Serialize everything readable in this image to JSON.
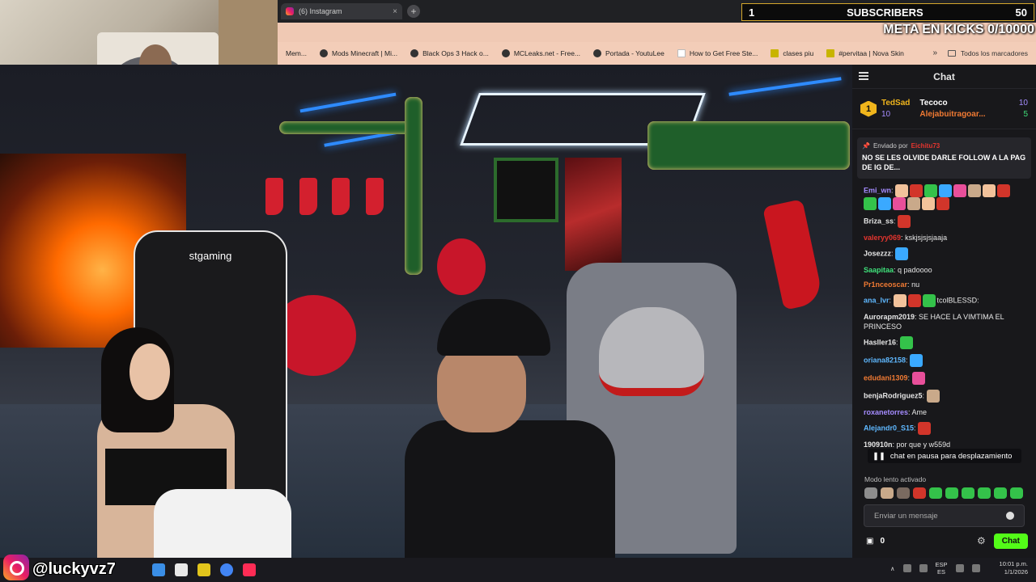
{
  "browser": {
    "tab_title": "(6) Instagram",
    "tab_close": "×",
    "new_tab": "+",
    "window_controls": [
      "—",
      "▢",
      "✕"
    ],
    "bookmarks": [
      {
        "label": "Mem..."
      },
      {
        "label": "Mods Minecraft | Mi..."
      },
      {
        "label": "Black Ops 3 Hack o..."
      },
      {
        "label": "MCLeaks.net - Free..."
      },
      {
        "label": "Portada - YoutuLee"
      },
      {
        "label": "How to Get Free Ste..."
      },
      {
        "label": "clases piu"
      },
      {
        "label": "#pervitaa | Nova Skin"
      }
    ],
    "bookmarks_more": "»",
    "all_bookmarks": "Todos los marcadores"
  },
  "overlay": {
    "subs_count": "1",
    "subs_label": "SUBSCRIBERS",
    "subs_goal": "50",
    "meta": "META EN KICKS 0/10000"
  },
  "stream": {
    "chair_brand": "stgaming"
  },
  "chat": {
    "title": "Chat",
    "leaderboard": {
      "rank": "1",
      "top_name": "TedSad",
      "top_count": "10",
      "second_name": "Tecoco",
      "second_count": "10",
      "third_name": "Alejabuitragoar...",
      "third_count": "5"
    },
    "pinned": {
      "by_label": "Enviado por",
      "by_user": "Eichitu73",
      "message": "NO SE LES OLVIDE DARLE FOLLOW A LA PAG DE IG DE..."
    },
    "messages": [
      {
        "user": "Emi_wn",
        "text": "",
        "color": "#a58cff",
        "emotes": 14
      },
      {
        "user": "Briza_ss",
        "text": "",
        "color": "#e6e6e6",
        "emotes": 1
      },
      {
        "user": "valeryy069",
        "text": "kskjsjsjsjaaja",
        "color": "#e5352e",
        "emotes": 0
      },
      {
        "user": "Josezzz",
        "text": "",
        "color": "#e6e6e6",
        "emotes": 1
      },
      {
        "user": "Saapitaa",
        "text": "q padoooo",
        "color": "#3fe07a",
        "emotes": 0
      },
      {
        "user": "Pr1nceoscar",
        "text": "nu",
        "color": "#f07a33",
        "emotes": 0
      },
      {
        "user": "ana_lvr",
        "text": "tcolBLESSD:",
        "color": "#5fb8ff",
        "emotes": 3
      },
      {
        "user": "Aurorapm2019",
        "text": "SE HACE LA VIMTIMA EL PRINCESO",
        "color": "#e6e6e6",
        "emotes": 0
      },
      {
        "user": "Hasller16",
        "text": "",
        "color": "#e6e6e6",
        "emotes": 1
      },
      {
        "user": "oriana82158",
        "text": "",
        "color": "#5fb8ff",
        "emotes": 1
      },
      {
        "user": "edudani1309",
        "text": "",
        "color": "#f07a33",
        "emotes": 1
      },
      {
        "user": "benjaRodriguez5",
        "text": "",
        "color": "#e6e6e6",
        "emotes": 1
      },
      {
        "user": "roxanetorres",
        "text": "Ame",
        "color": "#a58cff",
        "emotes": 0
      },
      {
        "user": "Alejandr0_S15",
        "text": "",
        "color": "#5fb8ff",
        "emotes": 1
      },
      {
        "user": "190910n",
        "text": "por que y w559d",
        "color": "#e6e6e6",
        "emotes": 0
      }
    ],
    "paused": "chat en pausa para desplazamiento",
    "slow_mode": "Modo lento activado",
    "input_placeholder": "Enviar un mensaje",
    "footer_count": "0",
    "send_button": "Chat"
  },
  "taskbar": {
    "handle": "@luckyvz7",
    "lang": "ESP",
    "region": "ES",
    "time": "10:01 p.m.",
    "date": "1/1/2026"
  }
}
